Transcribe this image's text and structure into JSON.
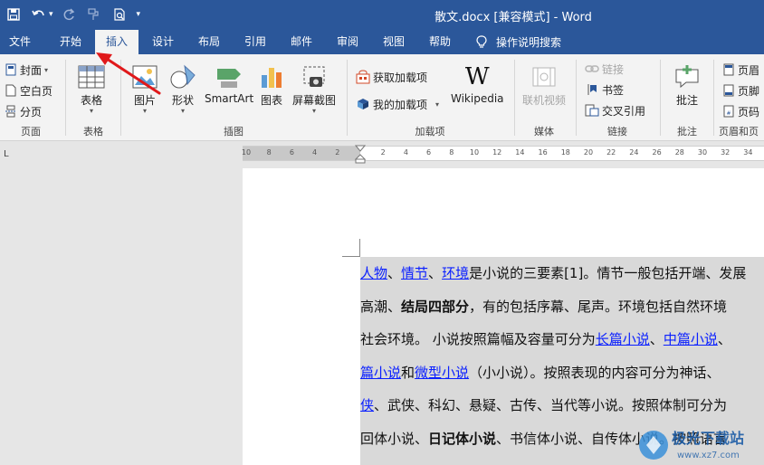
{
  "title_bar": {
    "title": "散文.docx [兼容模式]  -  Word"
  },
  "tabs": [
    {
      "label": "文件"
    },
    {
      "label": "开始"
    },
    {
      "label": "插入"
    },
    {
      "label": "设计"
    },
    {
      "label": "布局"
    },
    {
      "label": "引用"
    },
    {
      "label": "邮件"
    },
    {
      "label": "审阅"
    },
    {
      "label": "视图"
    },
    {
      "label": "帮助"
    }
  ],
  "active_tab": "插入",
  "tell_me": "操作说明搜索",
  "ribbon": {
    "pages": {
      "cover": "封面",
      "blank": "空白页",
      "break": "分页",
      "label": "页面"
    },
    "tables": {
      "table": "表格",
      "label": "表格"
    },
    "illustrations": {
      "picture": "图片",
      "shapes": "形状",
      "smartart": "SmartArt",
      "chart": "图表",
      "screenshot": "屏幕截图",
      "label": "插图"
    },
    "addins": {
      "get": "获取加载项",
      "my": "我的加载项",
      "wikipedia": "Wikipedia",
      "label": "加载项"
    },
    "media": {
      "video": "联机视频",
      "label": "媒体"
    },
    "links": {
      "link": "链接",
      "bookmark": "书签",
      "crossref": "交叉引用",
      "label": "链接"
    },
    "comments": {
      "comment": "批注",
      "label": "批注"
    },
    "header_footer": {
      "header": "页眉",
      "footer": "页脚",
      "page_number": "页码",
      "label": "页眉和页"
    }
  },
  "ruler": {
    "corner": "L",
    "ticks": [
      "10",
      "8",
      "6",
      "4",
      "2",
      "2",
      "4",
      "6",
      "8",
      "10",
      "12",
      "14",
      "16",
      "18",
      "20",
      "22",
      "24",
      "26",
      "28",
      "30",
      "32",
      "34"
    ]
  },
  "document": {
    "lines": [
      [
        {
          "t": "人物",
          "link": true
        },
        {
          "t": "、"
        },
        {
          "t": "情节",
          "link": true
        },
        {
          "t": "、"
        },
        {
          "t": "环境",
          "link": true
        },
        {
          "t": "是小说的三要素[1]。情节一般包括开端、发展"
        }
      ],
      [
        {
          "t": "高潮、"
        },
        {
          "t": "结局四部分",
          "bold": true
        },
        {
          "t": "，有的包括序幕、尾声。环境包括自然环境"
        }
      ],
      [
        {
          "t": "社会环境。 小说按照篇幅及容量可分为"
        },
        {
          "t": "长篇小说",
          "link": true
        },
        {
          "t": "、"
        },
        {
          "t": "中篇小说",
          "link": true
        },
        {
          "t": "、"
        }
      ],
      [
        {
          "t": "篇小说",
          "link": true
        },
        {
          "t": "和"
        },
        {
          "t": "微型小说",
          "link": true
        },
        {
          "t": "（小小说）。按照表现的内容可分为神话、"
        }
      ],
      [
        {
          "t": "侠",
          "link": true
        },
        {
          "t": "、武侠、科幻、悬疑、古传、当代等小说。按照体制可分为"
        }
      ],
      [
        {
          "t": "回体小说、"
        },
        {
          "t": "日记体小说",
          "bold": true
        },
        {
          "t": "、书信体小说、自传体小说。按照语言"
        }
      ]
    ]
  },
  "watermark": {
    "text": "极光下载站",
    "url": "www.xz7.com"
  },
  "colors": {
    "brand": "#2b579a",
    "link": "#0b20ff",
    "arrow": "#e0191b"
  }
}
